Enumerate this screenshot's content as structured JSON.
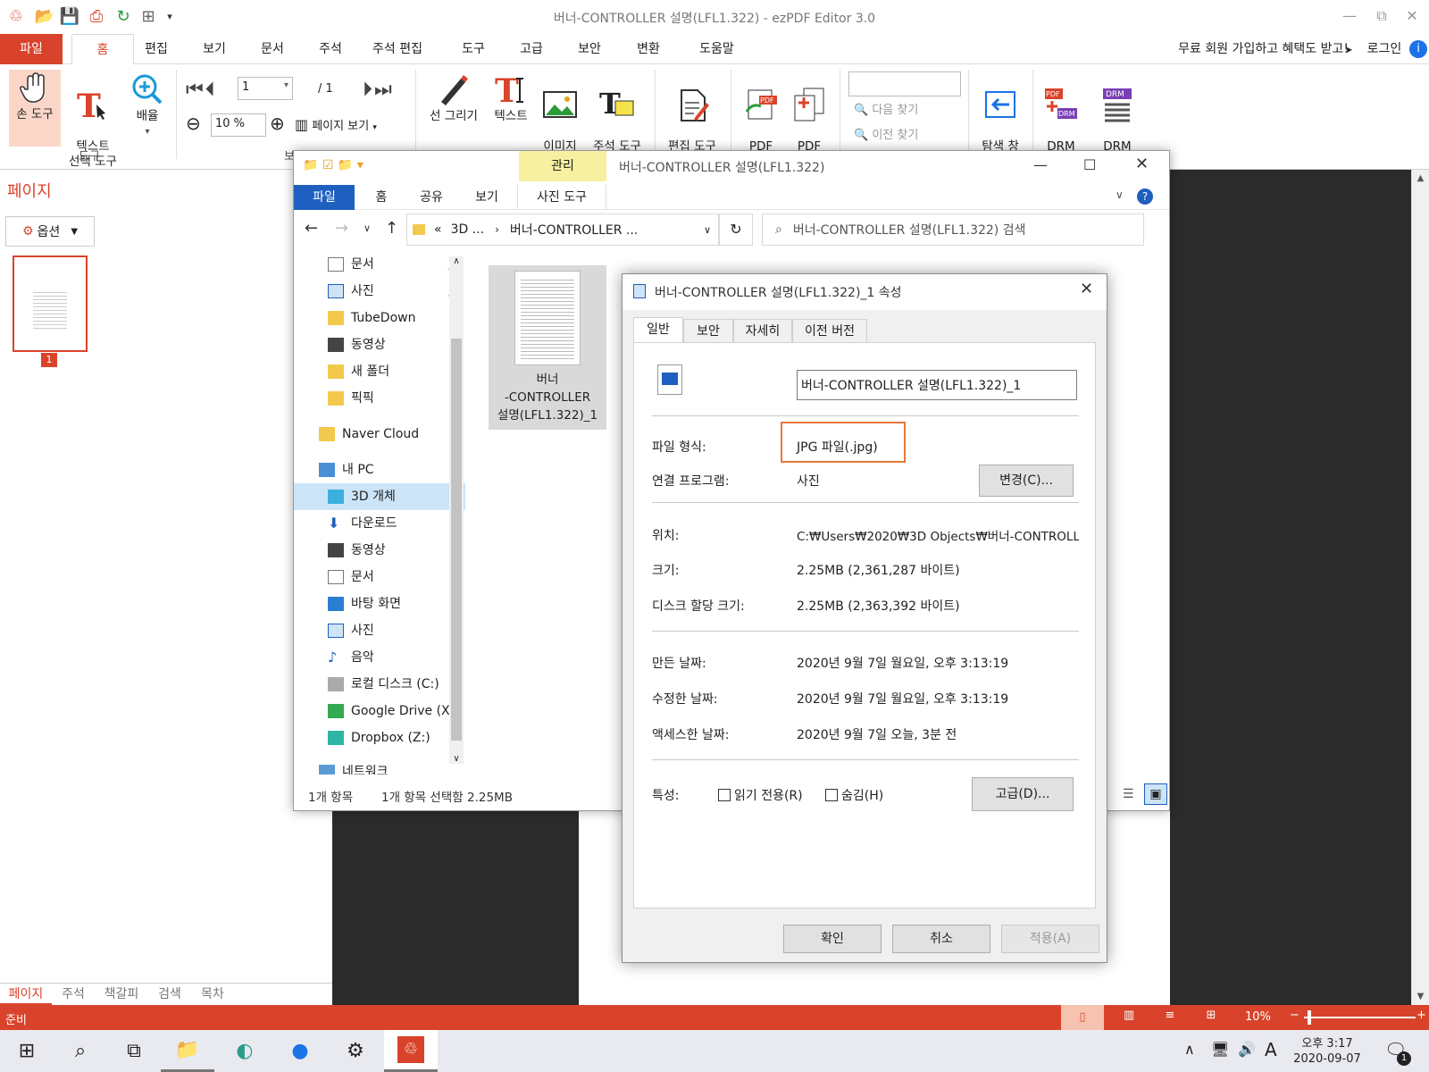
{
  "app": {
    "title": "버너-CONTROLLER 설명(LFL1.322) - ezPDF Editor 3.0",
    "tabs": [
      "파일",
      "홈",
      "편집",
      "보기",
      "문서",
      "주석",
      "주석 편집",
      "도구",
      "고급",
      "보안",
      "변환",
      "도움말"
    ],
    "promo": "무료 회원 가입하고 혜택도 받고!",
    "login": "로그인"
  },
  "ribbon": {
    "hand_tool": "손 도구",
    "text_select": "텍스트\n선택 도구",
    "zoom": "배율",
    "group_tool": "도구",
    "page_number": "1",
    "page_total": "/ 1",
    "zoom_value": "10 %",
    "page_view": "페이지 보기",
    "draw_line": "선 그리기",
    "text": "텍스트",
    "insert_image": "이미지\n삽입",
    "annot_tools": "주석 도구\n모음",
    "edit_tools": "편집 도구\n모음",
    "pdf_convert": "PDF\n변환",
    "pdf_merge": "PDF\n병합",
    "find_next": "다음 찾기",
    "find_prev": "이전 찾기",
    "hide_nav": "탐색 창\n숨기기",
    "drm_create": "DRM\n생성",
    "drm_history": "DRM\n이력 관리"
  },
  "left_panel": {
    "title": "페이지",
    "options": "옵션",
    "thumb_number": "1",
    "bottom_tabs": [
      "페이지",
      "주석",
      "책갈피",
      "검색",
      "목차"
    ]
  },
  "status": {
    "ready": "준비",
    "zoom": "10%"
  },
  "taskbar": {
    "ampm_time": "오후 3:17",
    "date": "2020-09-07",
    "ime": "A",
    "notif": "1"
  },
  "explorer": {
    "title": "버너-CONTROLLER 설명(LFL1.322)",
    "manage": "관리",
    "tabs": [
      "파일",
      "홈",
      "공유",
      "보기",
      "사진 도구"
    ],
    "breadcrumb": [
      "3D ...",
      "버너-CONTROLLER ..."
    ],
    "search_placeholder": "버너-CONTROLLER 설명(LFL1.322) 검색",
    "nav": [
      {
        "label": "문서",
        "icon": "document-icon"
      },
      {
        "label": "사진",
        "icon": "picture-icon"
      },
      {
        "label": "TubeDown",
        "icon": "folder-icon"
      },
      {
        "label": "동영상",
        "icon": "video-icon"
      },
      {
        "label": "새 폴더",
        "icon": "folder-icon"
      },
      {
        "label": "픽픽",
        "icon": "folder-icon"
      },
      {
        "label": "Naver Cloud",
        "icon": "folder-icon"
      },
      {
        "label": "내 PC",
        "icon": "pc-icon"
      },
      {
        "label": "3D 개체",
        "icon": "cube-icon"
      },
      {
        "label": "다운로드",
        "icon": "download-icon"
      },
      {
        "label": "동영상",
        "icon": "video-icon"
      },
      {
        "label": "문서",
        "icon": "document-icon"
      },
      {
        "label": "바탕 화면",
        "icon": "desktop-icon"
      },
      {
        "label": "사진",
        "icon": "picture-icon"
      },
      {
        "label": "음악",
        "icon": "music-icon"
      },
      {
        "label": "로컬 디스크 (C:)",
        "icon": "drive-icon"
      },
      {
        "label": "Google Drive (X",
        "icon": "google-drive-icon"
      },
      {
        "label": "Dropbox (Z:)",
        "icon": "dropbox-icon"
      },
      {
        "label": "네트워크",
        "icon": "network-icon"
      }
    ],
    "file_name": "버너\n-CONTROLLER\n설명(LFL1.322)_1",
    "status_count": "1개 항목",
    "status_selected": "1개 항목 선택함 2.25MB"
  },
  "properties": {
    "title": "버너-CONTROLLER 설명(LFL1.322)_1 속성",
    "tabs": [
      "일반",
      "보안",
      "자세히",
      "이전 버전"
    ],
    "name_value": "버너-CONTROLLER 설명(LFL1.322)_1",
    "file_type_label": "파일 형식:",
    "file_type": "JPG 파일(.jpg)",
    "opens_with_label": "연결 프로그램:",
    "opens_with": "사진",
    "change_btn": "변경(C)...",
    "location_label": "위치:",
    "location": "C:₩Users₩2020₩3D Objects₩버너-CONTROLL",
    "size_label": "크기:",
    "size": "2.25MB (2,361,287 바이트)",
    "disk_size_label": "디스크 할당 크기:",
    "disk_size": "2.25MB (2,363,392 바이트)",
    "created_label": "만든 날짜:",
    "created": "2020년 9월 7일 월요일, 오후 3:13:19",
    "modified_label": "수정한 날짜:",
    "modified": "2020년 9월 7일 월요일, 오후 3:13:19",
    "accessed_label": "액세스한 날짜:",
    "accessed": "2020년 9월 7일 오늘, 3분 전",
    "attributes_label": "특성:",
    "readonly": "읽기 전용(R)",
    "hidden": "숨김(H)",
    "advanced_btn": "고급(D)...",
    "ok": "확인",
    "cancel": "취소",
    "apply": "적용(A)"
  },
  "colors": {
    "accent": "#d9432b",
    "highlight": "#e8793a",
    "explorer_blue": "#1f5fbf"
  }
}
